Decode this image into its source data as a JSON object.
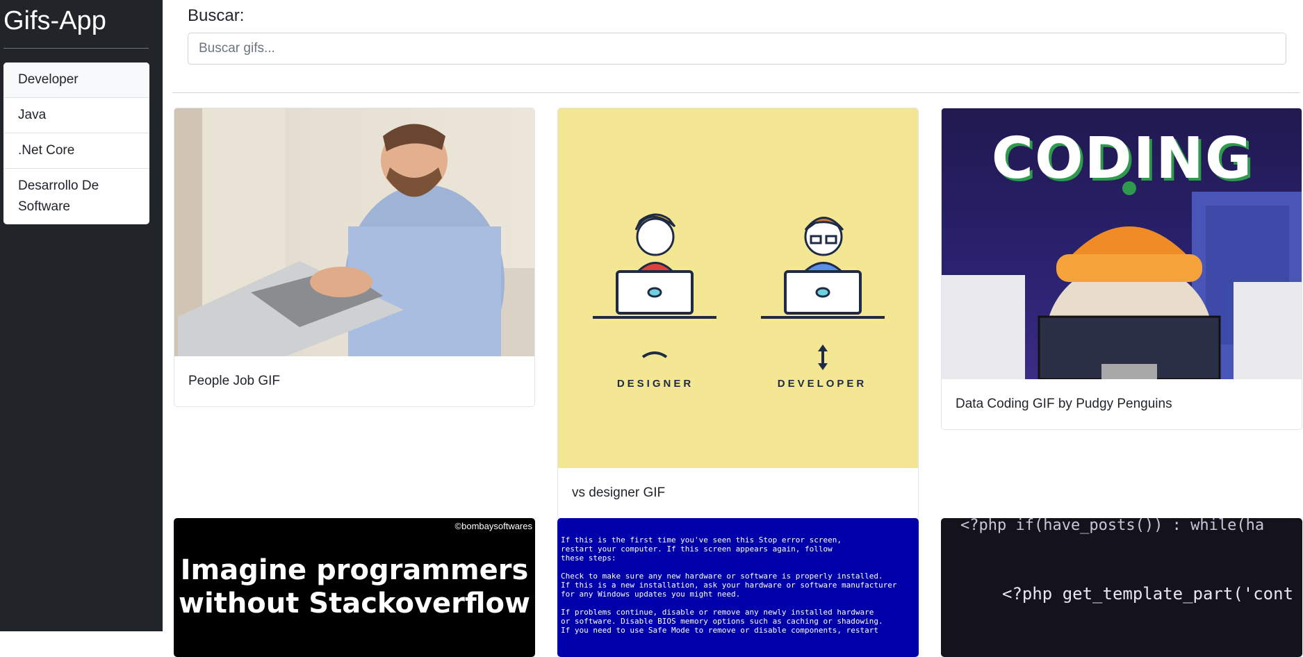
{
  "sidebar": {
    "title": "Gifs-App",
    "history": [
      "Developer",
      "Java",
      ".Net Core",
      "Desarrollo De Software"
    ]
  },
  "search": {
    "label": "Buscar:",
    "placeholder": "Buscar gifs..."
  },
  "gifs": [
    {
      "title": "People Job GIF"
    },
    {
      "title": "vs designer GIF",
      "image_text": [
        "DESIGNER",
        "DEVELOPER"
      ]
    },
    {
      "title": "Data Coding GIF by Pudgy Penguins",
      "image_text": "CODING"
    },
    {
      "title": "",
      "image_text": [
        "©bombaysoftwares",
        "Imagine programmers",
        "without Stackoverflow"
      ]
    },
    {
      "title": "",
      "image_text": [
        "If this is the first time you've seen this Stop error screen,",
        "restart your computer. If this screen appears again, follow",
        "these steps:",
        "",
        "Check to make sure any new hardware or software is properly installed.",
        "If this is a new installation, ask your hardware or software manufacturer",
        "for any Windows updates you might need.",
        "",
        "If problems continue, disable or remove any newly installed hardware",
        "or software. Disable BIOS memory options such as caching or shadowing.",
        "If you need to use Safe Mode to remove or disable components, restart"
      ]
    },
    {
      "title": "",
      "image_text": [
        "<?php if(have_posts()) : while(ha",
        "<?php get_template_part('cont"
      ]
    }
  ],
  "colors": {
    "sidebar_bg": "#212529",
    "card2_bg": "#f3e794",
    "bsod_bg": "#0000aa"
  }
}
